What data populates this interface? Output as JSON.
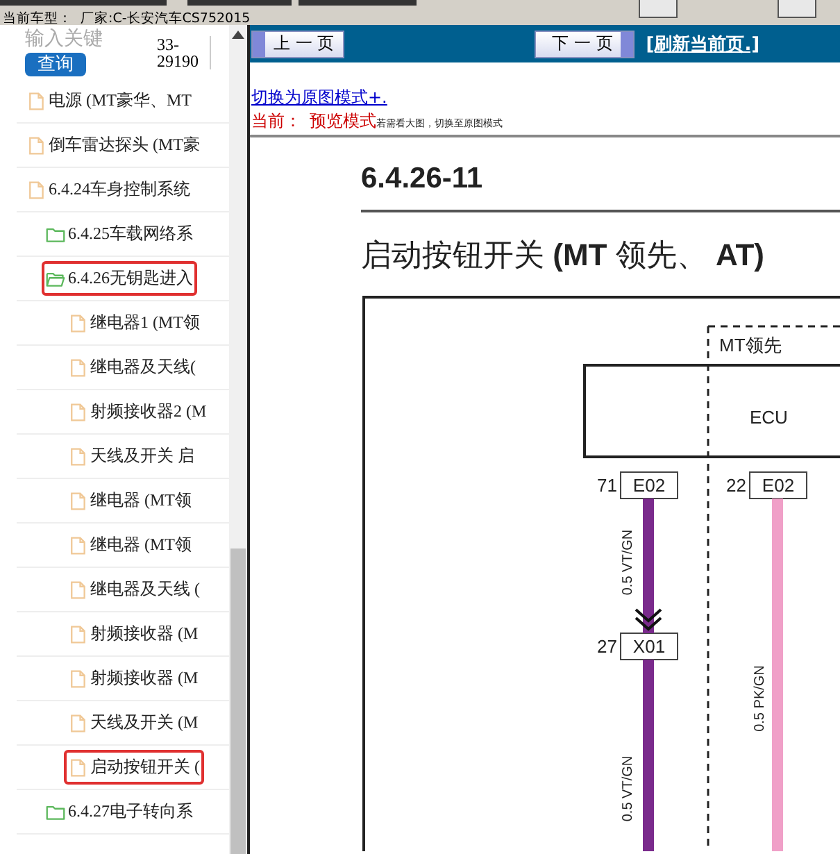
{
  "header": {
    "vehicle_label": "当前车型：",
    "vehicle_value": "厂家:C-长安汽车CS752015"
  },
  "search": {
    "placeholder": "输入关键",
    "button": "查询",
    "code": "33-29190"
  },
  "tree": [
    {
      "kind": "file",
      "label": "电源 (MT豪华、MT",
      "selected": false
    },
    {
      "kind": "file",
      "label": "倒车雷达探头 (MT豪",
      "selected": false
    },
    {
      "kind": "file",
      "label": "6.4.24车身控制系统",
      "selected": false
    },
    {
      "kind": "folder",
      "label": "6.4.25车载网络系",
      "selected": false,
      "expanded": false
    },
    {
      "kind": "folder",
      "label": "6.4.26无钥匙进入",
      "selected": true,
      "expanded": true,
      "children": [
        {
          "kind": "file",
          "label": "继电器1 (MT领",
          "selected": false
        },
        {
          "kind": "file",
          "label": "继电器及天线(",
          "selected": false
        },
        {
          "kind": "file",
          "label": "射频接收器2 (M",
          "selected": false
        },
        {
          "kind": "file",
          "label": "天线及开关 启",
          "selected": false
        },
        {
          "kind": "file",
          "label": "继电器 (MT领",
          "selected": false
        },
        {
          "kind": "file",
          "label": "继电器 (MT领",
          "selected": false
        },
        {
          "kind": "file",
          "label": "继电器及天线 (",
          "selected": false
        },
        {
          "kind": "file",
          "label": "射频接收器 (M",
          "selected": false
        },
        {
          "kind": "file",
          "label": "射频接收器 (M",
          "selected": false
        },
        {
          "kind": "file",
          "label": "天线及开关 (M",
          "selected": false
        },
        {
          "kind": "file",
          "label": "启动按钮开关 (",
          "selected": true
        }
      ]
    },
    {
      "kind": "folder",
      "label": "6.4.27电子转向系",
      "selected": false,
      "expanded": false
    }
  ],
  "nav": {
    "prev": "上 一 页",
    "next": "下 一 页",
    "refresh": "[刷新当前页.]"
  },
  "viewer": {
    "switch_link": "切换为原图模式+.",
    "mode_label": "当前：",
    "mode_value": "预览模式",
    "mode_hint": "若需看大图，切换至原图模式"
  },
  "document": {
    "page_number": "6.4.26-11",
    "title": "启动按钮开关 **(MT** 领先、 **AT)**",
    "diagram": {
      "region_label": "MT领先",
      "module": "ECU",
      "connectors": [
        {
          "pin": "71",
          "name": "E02"
        },
        {
          "pin": "22",
          "name": "E02"
        },
        {
          "pin": "27",
          "name": "X01"
        }
      ],
      "wires": [
        {
          "label": "0.5 VT/GN",
          "color": "#7a2a8c"
        },
        {
          "label": "0.5 PK/GN",
          "color": "#f0a0c8"
        },
        {
          "label": "0.5 VT/GN",
          "color": "#7a2a8c"
        }
      ]
    }
  }
}
